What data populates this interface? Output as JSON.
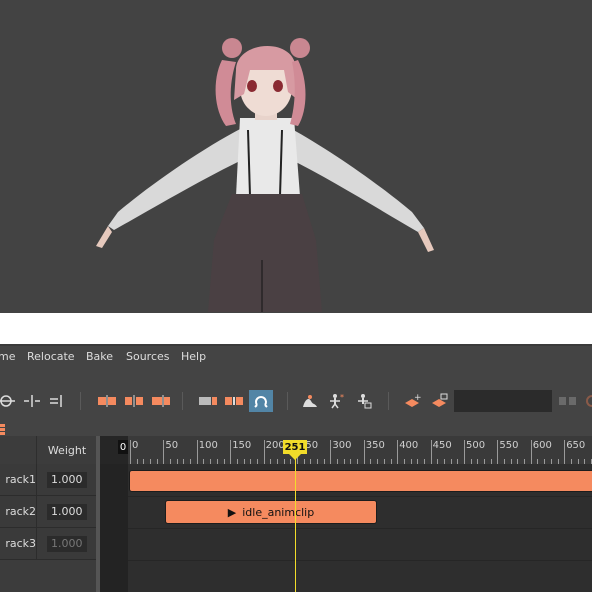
{
  "menu": {
    "items": [
      {
        "label": "me"
      },
      {
        "label": "Relocate"
      },
      {
        "label": "Bake"
      },
      {
        "label": "Sources"
      },
      {
        "label": "Help"
      }
    ]
  },
  "toolbar": {
    "search_value": "",
    "colors": {
      "accent_orange": "#f58a5f",
      "active_blue": "#5285a6"
    }
  },
  "tracks": {
    "weight_header": "Weight",
    "rows": [
      {
        "name": "rack1",
        "weight": "1.000",
        "dim": false
      },
      {
        "name": "rack2",
        "weight": "1.000",
        "dim": false
      },
      {
        "name": "rack3",
        "weight": "1.000",
        "dim": true
      }
    ]
  },
  "timeline": {
    "start_marker": "0",
    "ticks": [
      "0",
      "50",
      "100",
      "150",
      "200",
      "250",
      "300",
      "350",
      "400",
      "450",
      "500",
      "550",
      "600",
      "650"
    ],
    "playhead": "251",
    "clips": [
      {
        "track": 1,
        "label": ""
      },
      {
        "track": 2,
        "label": "idle_animclip",
        "icon": "play-icon"
      }
    ]
  }
}
